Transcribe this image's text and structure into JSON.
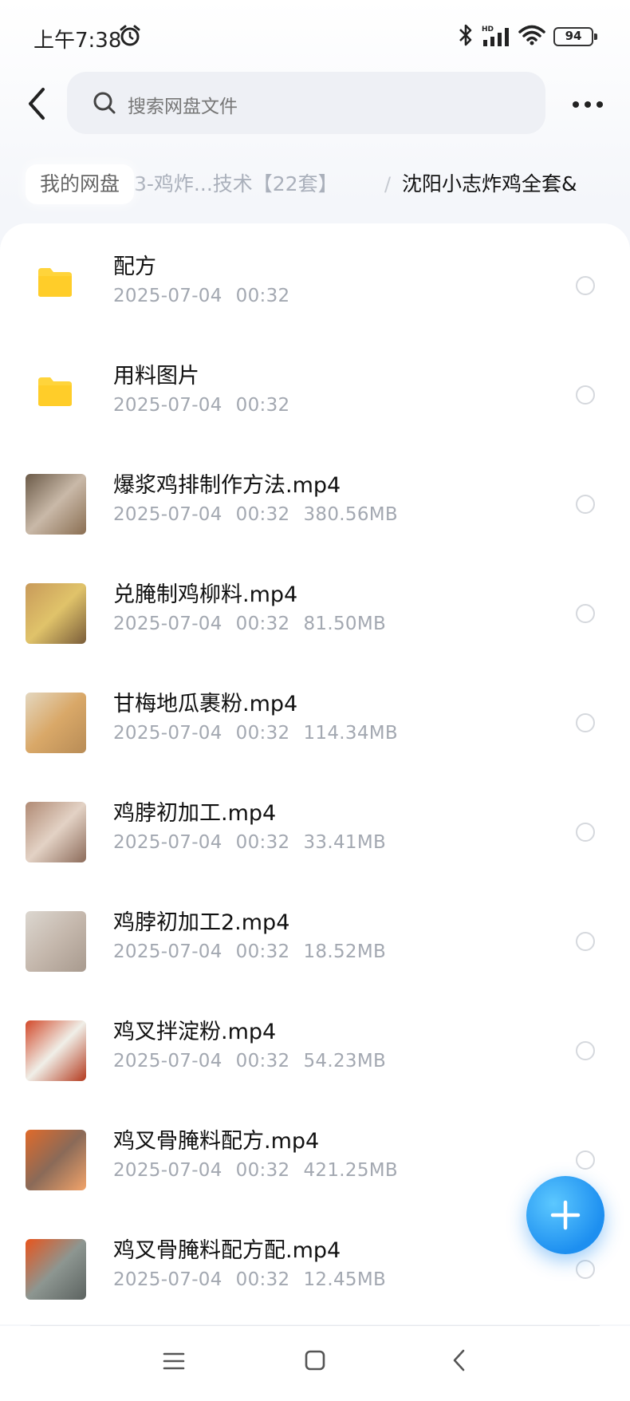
{
  "status_bar": {
    "time": "上午7:38",
    "battery": "94",
    "icons": [
      "alarm-icon",
      "bluetooth-icon",
      "hd-signal-icon",
      "wifi-icon",
      "battery-icon"
    ]
  },
  "header": {
    "search_placeholder": "搜索网盘文件"
  },
  "breadcrumb": {
    "root": "我的网盘",
    "middle": "3-鸡炸...技术【22套】",
    "separator": "/",
    "current": "沈阳小志炸鸡全套&"
  },
  "files": [
    {
      "name": "配方",
      "date": "2025-07-04",
      "time": "00:32",
      "size": "",
      "type": "folder"
    },
    {
      "name": "用料图片",
      "date": "2025-07-04",
      "time": "00:32",
      "size": "",
      "type": "folder"
    },
    {
      "name": "爆浆鸡排制作方法.mp4",
      "date": "2025-07-04",
      "time": "00:32",
      "size": "380.56MB",
      "type": "video"
    },
    {
      "name": "兑腌制鸡柳料.mp4",
      "date": "2025-07-04",
      "time": "00:32",
      "size": "81.50MB",
      "type": "video"
    },
    {
      "name": "甘梅地瓜裹粉.mp4",
      "date": "2025-07-04",
      "time": "00:32",
      "size": "114.34MB",
      "type": "video"
    },
    {
      "name": "鸡脖初加工.mp4",
      "date": "2025-07-04",
      "time": "00:32",
      "size": "33.41MB",
      "type": "video"
    },
    {
      "name": "鸡脖初加工2.mp4",
      "date": "2025-07-04",
      "time": "00:32",
      "size": "18.52MB",
      "type": "video"
    },
    {
      "name": "鸡叉拌淀粉.mp4",
      "date": "2025-07-04",
      "time": "00:32",
      "size": "54.23MB",
      "type": "video"
    },
    {
      "name": "鸡叉骨腌料配方.mp4",
      "date": "2025-07-04",
      "time": "00:32",
      "size": "421.25MB",
      "type": "video"
    },
    {
      "name": "鸡叉骨腌料配方配.mp4",
      "date": "2025-07-04",
      "time": "00:32",
      "size": "12.45MB",
      "type": "video"
    }
  ],
  "colors": {
    "accent": "#1d8ff0",
    "folder": "#ffd43b",
    "meta_text": "#a3a8b1"
  }
}
